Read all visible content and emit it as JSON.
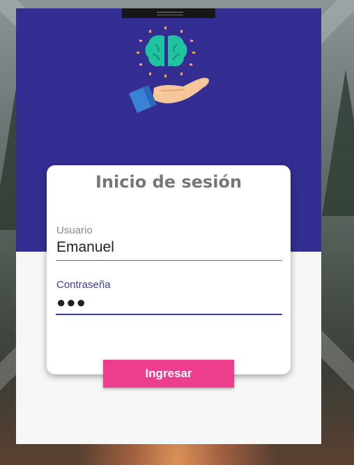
{
  "login": {
    "title": "Inicio de sesión",
    "username_label": "Usuario",
    "username_value": "Emanuel",
    "password_label": "Contraseña",
    "password_value": "●●●",
    "submit_label": "Ingresar"
  },
  "icons": {
    "hero": "brain-in-hand-icon"
  },
  "colors": {
    "header": "#342e93",
    "accent": "#3b3f9c",
    "submit": "#ec3e8c",
    "brain": "#1fc3a0",
    "hand": "#f6c79a",
    "sleeve": "#3a82d6"
  }
}
